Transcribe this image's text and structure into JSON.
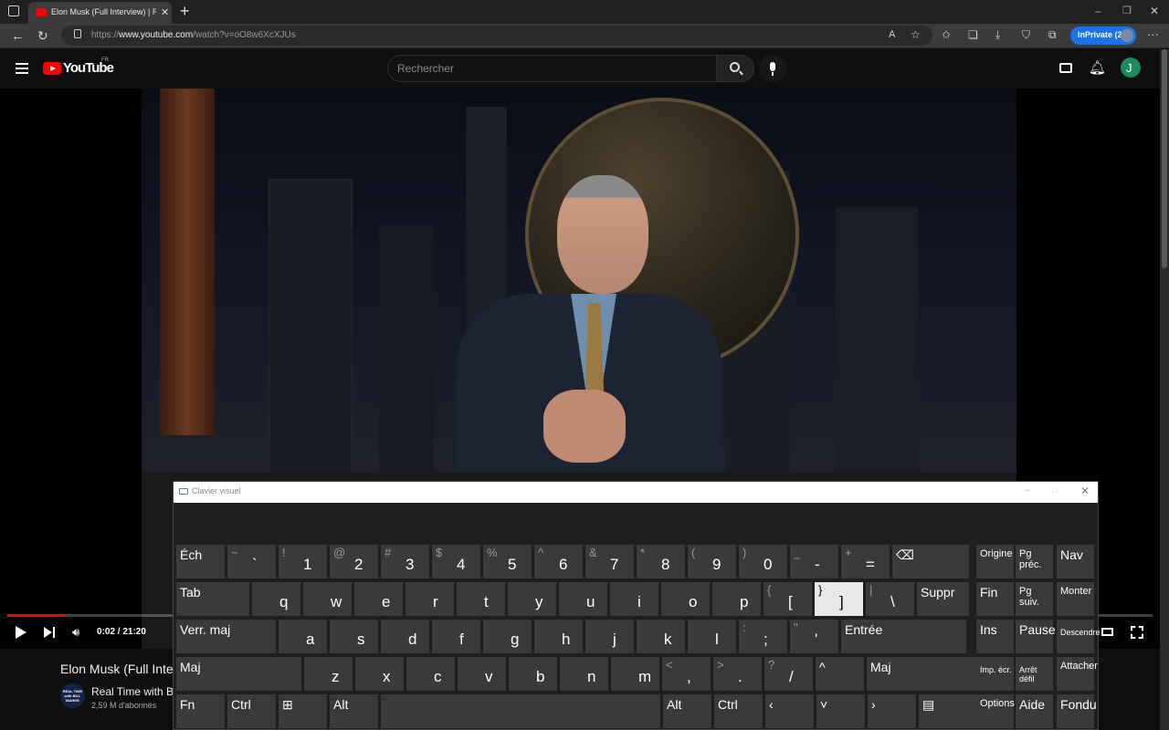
{
  "browser": {
    "tab_title": "Elon Musk (Full Interview) | Real ",
    "url_prefix": "https://",
    "url_domain": "www.youtube.com",
    "url_path": "/watch?v=oO8w6XcXJUs",
    "inprivate_label": "InPrivate (2)"
  },
  "youtube": {
    "logo_text": "YouTube",
    "country_code": "FR",
    "search_placeholder": "Rechercher",
    "avatar_letter": "J"
  },
  "player": {
    "time_display": "0:02 / 21:20",
    "progress_fraction": 0.05
  },
  "video_info": {
    "title": "Elon Musk (Full Interv",
    "channel_name": "Real Time with Bill",
    "subscribers": "2,59 M d'abonnés",
    "channel_avatar_text": "REAL TIME with BILL MAHER"
  },
  "osk": {
    "title": "Clavier visuel",
    "rows": [
      [
        {
          "label": "Éch"
        },
        {
          "shift": "~",
          "main": "`"
        },
        {
          "shift": "!",
          "main": "1"
        },
        {
          "shift": "@",
          "main": "2"
        },
        {
          "shift": "#",
          "main": "3"
        },
        {
          "shift": "$",
          "main": "4"
        },
        {
          "shift": "%",
          "main": "5"
        },
        {
          "shift": "^",
          "main": "6"
        },
        {
          "shift": "&",
          "main": "7"
        },
        {
          "shift": "*",
          "main": "8"
        },
        {
          "shift": "(",
          "main": "9"
        },
        {
          "shift": ")",
          "main": "0"
        },
        {
          "shift": "_",
          "main": "-"
        },
        {
          "shift": "+",
          "main": "="
        },
        {
          "label": "⌫"
        }
      ],
      [
        {
          "label": "Tab"
        },
        {
          "main": "q"
        },
        {
          "main": "w"
        },
        {
          "main": "e"
        },
        {
          "main": "r"
        },
        {
          "main": "t"
        },
        {
          "main": "y"
        },
        {
          "main": "u"
        },
        {
          "main": "i"
        },
        {
          "main": "o"
        },
        {
          "main": "p"
        },
        {
          "shift": "{",
          "main": "["
        },
        {
          "shift": "}",
          "main": "]"
        },
        {
          "shift": "|",
          "main": "\\"
        },
        {
          "label": "Suppr"
        }
      ],
      [
        {
          "label": "Verr. maj"
        },
        {
          "main": "a"
        },
        {
          "main": "s"
        },
        {
          "main": "d"
        },
        {
          "main": "f"
        },
        {
          "main": "g"
        },
        {
          "main": "h"
        },
        {
          "main": "j"
        },
        {
          "main": "k"
        },
        {
          "main": "l"
        },
        {
          "shift": ":",
          "main": ";"
        },
        {
          "shift": "\"",
          "main": "'"
        },
        {
          "label": "Entrée"
        }
      ],
      [
        {
          "label": "Maj"
        },
        {
          "main": "z"
        },
        {
          "main": "x"
        },
        {
          "main": "c"
        },
        {
          "main": "v"
        },
        {
          "main": "b"
        },
        {
          "main": "n"
        },
        {
          "main": "m"
        },
        {
          "shift": "<",
          "main": ","
        },
        {
          "shift": ">",
          "main": "."
        },
        {
          "shift": "?",
          "main": "/"
        },
        {
          "label": "^"
        },
        {
          "label": "Maj"
        }
      ],
      [
        {
          "label": "Fn"
        },
        {
          "label": "Ctrl"
        },
        {
          "label": "⊞"
        },
        {
          "label": "Alt"
        },
        {
          "label": ""
        },
        {
          "label": "Alt"
        },
        {
          "label": "Ctrl"
        },
        {
          "label": "‹"
        },
        {
          "label": "˅"
        },
        {
          "label": "›"
        },
        {
          "label": "▤"
        }
      ]
    ],
    "nav_keys": [
      [
        "Origine",
        "Pg préc.",
        "Nav"
      ],
      [
        "Fin",
        "Pg suiv.",
        "Monter"
      ],
      [
        "Ins",
        "Pause",
        "Descendre"
      ],
      [
        "Imp. écr.",
        "Arrêt défil",
        "Attacher"
      ],
      [
        "Options",
        "Aide",
        "Fondu"
      ]
    ],
    "pressed_key": "]"
  },
  "colors": {
    "youtube_red": "#ff0000",
    "inprivate_blue": "#1a73e8",
    "avatar_green": "#1e8c5e"
  }
}
